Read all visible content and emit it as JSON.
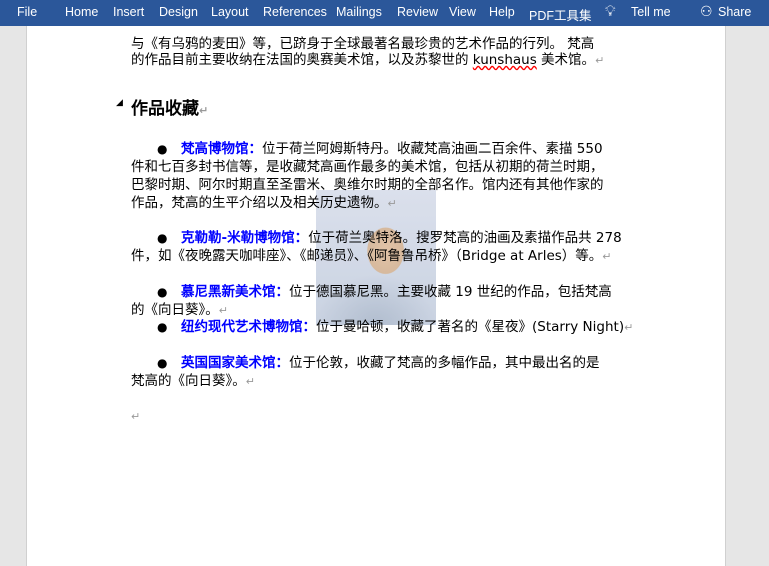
{
  "ribbon": {
    "tabs": [
      "File",
      "Home",
      "Insert",
      "Design",
      "Layout",
      "References",
      "Mailings",
      "Review",
      "View",
      "Help",
      "PDF工具集"
    ],
    "tell_me": "Tell me",
    "share": "Share"
  },
  "doc": {
    "intro_line2": "与《有乌鸦的麦田》等，已跻身于全球最著名最珍贵的艺术作品的行列。 梵高",
    "intro_line3a": "的作品目前主要收纳在法国的奥赛美术馆，以及苏黎世的 ",
    "intro_kunshaus": "kunshaus",
    "intro_line3b": " 美术馆。",
    "heading": "作品收藏",
    "items": [
      {
        "name": "梵高博物馆：",
        "lines": [
          "位于荷兰阿姆斯特丹。收藏梵高油画二百余件、素描 550",
          "件和七百多封书信等，是收藏梵高画作最多的美术馆，包括从初期的荷兰时期，",
          "巴黎时期、阿尔时期直至圣雷米、奥维尔时期的全部名作。馆内还有其他作家的",
          "作品，梵高的生平介绍以及相关历史遗物。"
        ]
      },
      {
        "name": "克勒勒-米勒博物馆：",
        "lines": [
          "位于荷兰奥特洛。搜罗梵高的油画及素描作品共 278",
          "件，如《夜晚露天咖啡座》、《邮递员》、《阿鲁鲁吊桥》（Bridge at Arles）等。"
        ]
      },
      {
        "name": "慕尼黑新美术馆：",
        "lines": [
          "位于德国慕尼黑。主要收藏 19 世纪的作品，包括梵高",
          "的《向日葵》。"
        ]
      },
      {
        "name": "纽约现代艺术博物馆：",
        "lines": [
          "位于曼哈顿，收藏了著名的《星夜》(Starry Night)"
        ]
      },
      {
        "name": "英国国家美术馆：",
        "lines": [
          "位于伦敦，收藏了梵高的多幅作品，其中最出名的是",
          "梵高的《向日葵》。"
        ]
      }
    ]
  }
}
